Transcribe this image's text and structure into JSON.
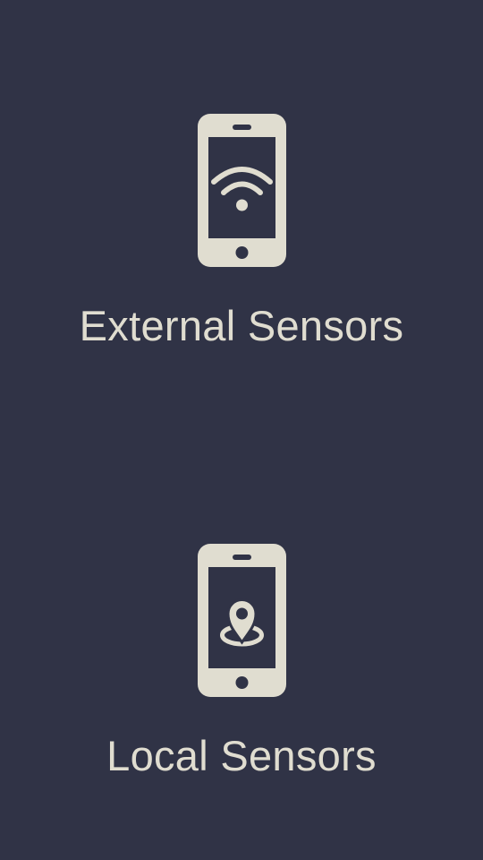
{
  "colors": {
    "background": "#303346",
    "foreground": "#e0ddd0",
    "divider": "#1c1e2a"
  },
  "options": [
    {
      "label": "External Sensors",
      "icon": "phone-wifi-icon"
    },
    {
      "label": "Local Sensors",
      "icon": "phone-location-icon"
    }
  ]
}
